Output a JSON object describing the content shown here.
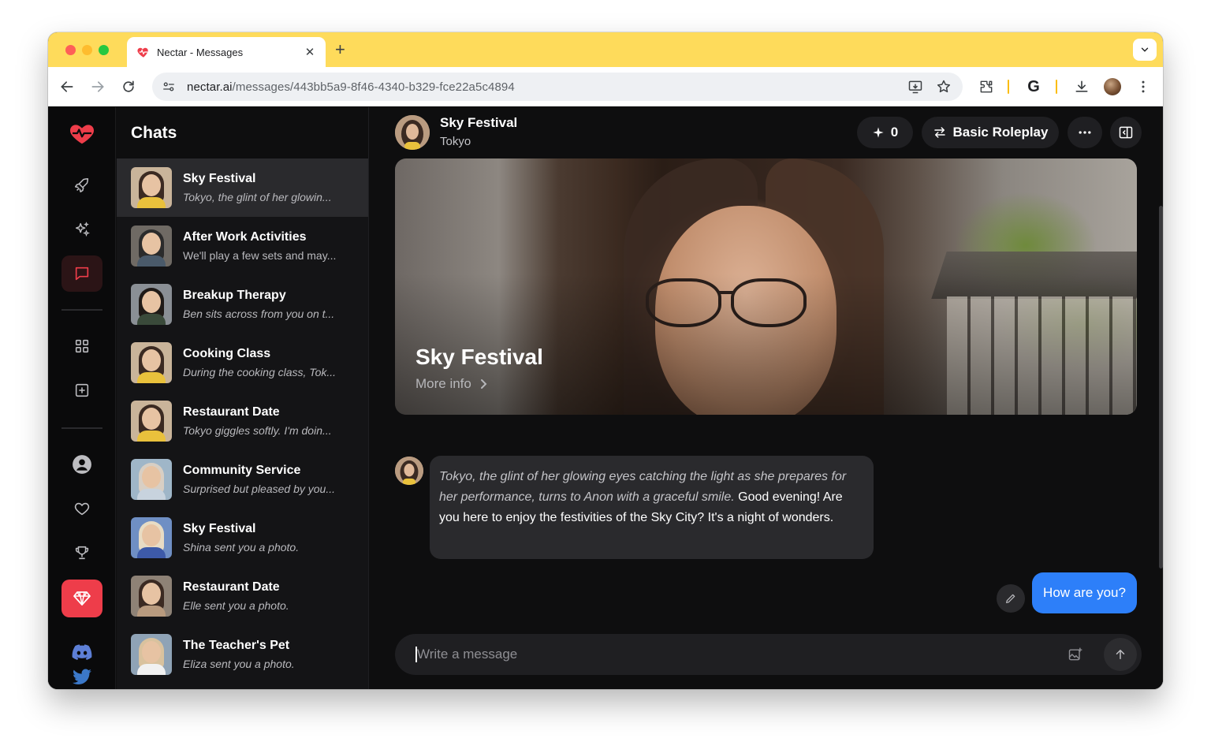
{
  "browser": {
    "tab_title": "Nectar - Messages",
    "tab_close": "✕",
    "new_tab": "+",
    "url_host": "nectar.ai",
    "url_path": "/messages/443bb5a9-8f46-4340-b329-fce22a5c4894",
    "profile_initial": "G"
  },
  "sidebar_rail": {
    "items": [
      {
        "icon": "heart-pulse-logo-icon"
      },
      {
        "icon": "rocket-icon"
      },
      {
        "icon": "sparkles-icon"
      },
      {
        "icon": "chat-bubble-icon",
        "active": true
      },
      {
        "icon": "grid-icon"
      },
      {
        "icon": "plus-square-icon"
      },
      {
        "icon": "user-icon"
      },
      {
        "icon": "heart-icon"
      },
      {
        "icon": "trophy-icon"
      },
      {
        "icon": "gem-icon",
        "premium": true
      },
      {
        "icon": "discord-icon"
      },
      {
        "icon": "twitter-icon"
      }
    ]
  },
  "chats": {
    "title": "Chats",
    "items": [
      {
        "title": "Sky Festival",
        "preview": "Tokyo, the glint of her glowin...",
        "italic": true,
        "selected": true
      },
      {
        "title": "After Work Activities",
        "preview": "We'll play a few sets and may...",
        "italic": false
      },
      {
        "title": "Breakup Therapy",
        "preview": "Ben sits across from you on t...",
        "italic": true
      },
      {
        "title": "Cooking Class",
        "preview": "During the cooking class, Tok...",
        "italic": true
      },
      {
        "title": "Restaurant Date",
        "preview": "Tokyo giggles softly. I'm doin...",
        "italic": true
      },
      {
        "title": "Community Service",
        "preview": "Surprised but pleased by you...",
        "italic": true
      },
      {
        "title": "Sky Festival",
        "preview": "Shina sent you a photo.",
        "italic": true
      },
      {
        "title": "Restaurant Date",
        "preview": "Elle sent you a photo.",
        "italic": true
      },
      {
        "title": "The Teacher's Pet",
        "preview": "Eliza sent you a photo.",
        "italic": true
      }
    ]
  },
  "conversation": {
    "title": "Sky Festival",
    "character": "Tokyo",
    "points_label": "0",
    "mode_label": "Basic Roleplay",
    "hero_title": "Sky Festival",
    "hero_more": "More info",
    "bot_message": {
      "narration": "Tokyo, the glint of her glowing eyes catching the light as she prepares for her performance, turns to Anon with a graceful smile.",
      "speech": "Good evening! Are you here to enjoy the festivities of the Sky City? It's a night of wonders."
    },
    "user_message": "How are you?",
    "composer_placeholder": "Write a message"
  },
  "colors": {
    "brand_red": "#ee3d4a",
    "user_bubble": "#2d7ff9",
    "browser_tabstrip": "#fedb5b"
  }
}
